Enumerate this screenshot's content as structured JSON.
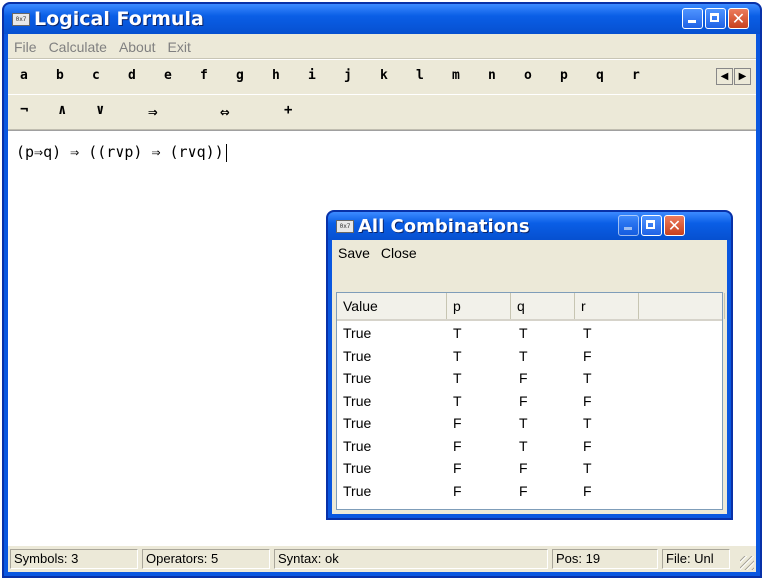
{
  "main_window": {
    "title": "Logical Formula",
    "icon_text": "0x7"
  },
  "menu": [
    "File",
    "Calculate",
    "About",
    "Exit"
  ],
  "letters": [
    "a",
    "b",
    "c",
    "d",
    "e",
    "f",
    "g",
    "h",
    "i",
    "j",
    "k",
    "l",
    "m",
    "n",
    "o",
    "p",
    "q",
    "r"
  ],
  "operators": [
    "¬",
    "∧",
    "∨",
    "⇒",
    "⇔",
    "+"
  ],
  "formula": "(p⇒q) ⇒ ((r∨p) ⇒ (r∨q))",
  "status": {
    "symbols": "Symbols: 3",
    "operators": "Operators: 5",
    "syntax": "Syntax: ok",
    "pos": "Pos: 19",
    "file": "File: Unl"
  },
  "dialog": {
    "title": "All Combinations",
    "icon_text": "0x7",
    "menu": [
      "Save",
      "Close"
    ],
    "columns": [
      "Value",
      "p",
      "q",
      "r",
      ""
    ],
    "rows": [
      [
        "True",
        "T",
        "T",
        "T"
      ],
      [
        "True",
        "T",
        "T",
        "F"
      ],
      [
        "True",
        "T",
        "F",
        "T"
      ],
      [
        "True",
        "T",
        "F",
        "F"
      ],
      [
        "True",
        "F",
        "T",
        "T"
      ],
      [
        "True",
        "F",
        "T",
        "F"
      ],
      [
        "True",
        "F",
        "F",
        "T"
      ],
      [
        "True",
        "F",
        "F",
        "F"
      ]
    ]
  },
  "colors": {
    "xp_blue": "#0a57e0",
    "face": "#ece9d8",
    "close_red": "#c8401d"
  }
}
